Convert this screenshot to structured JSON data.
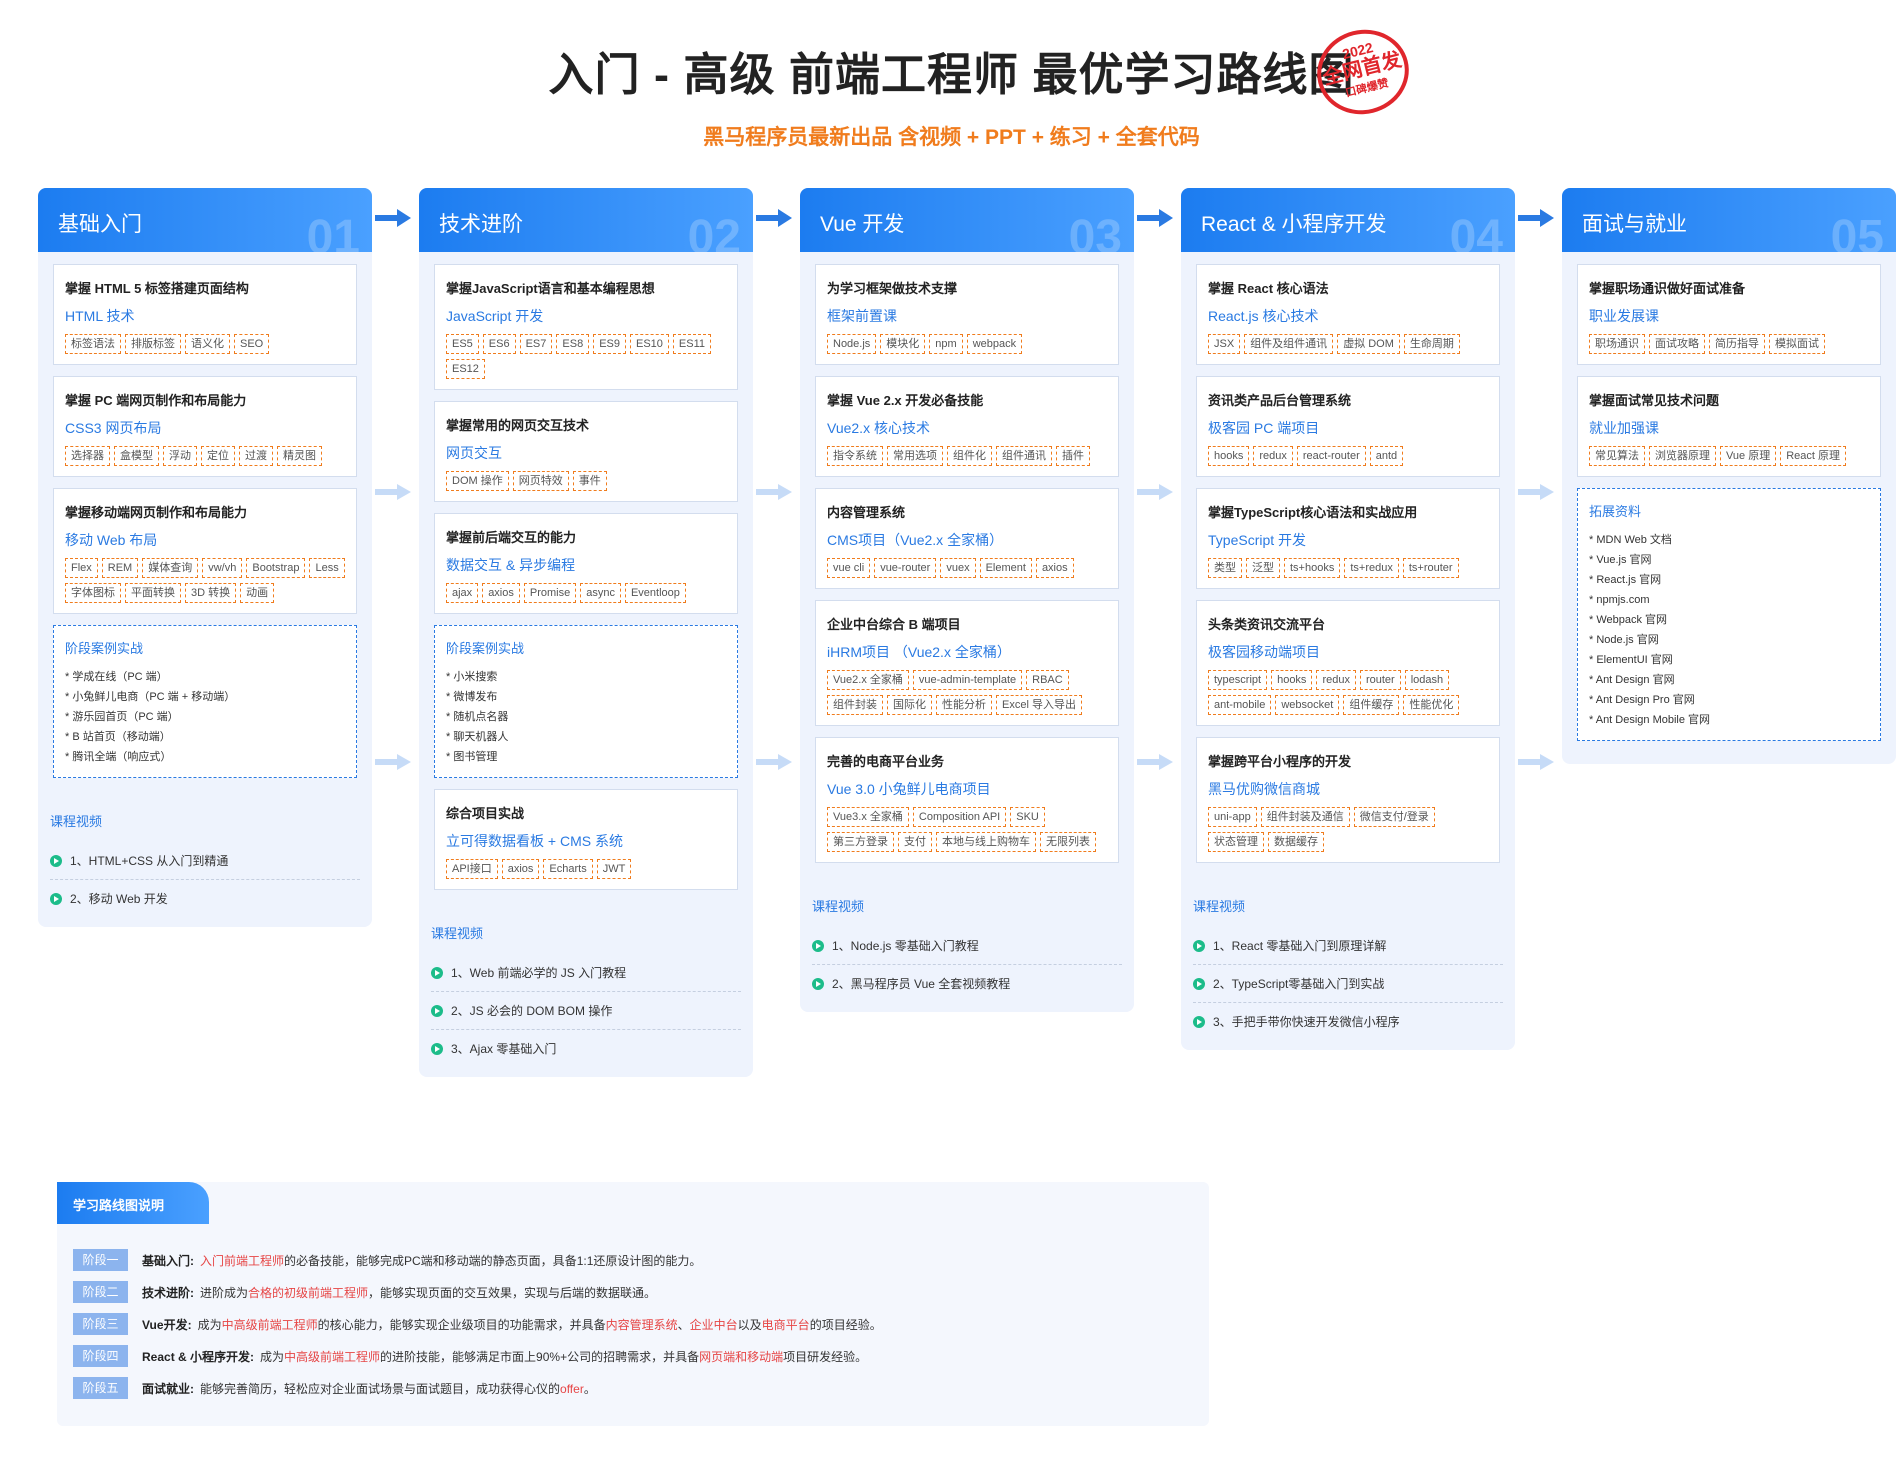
{
  "header": {
    "title": "入门 - 高级 前端工程师 最优学习路线图",
    "subtitle": "黑马程序员最新出品 含视频 + PPT + 练习 + 全套代码",
    "stamp": {
      "year": "2022",
      "main": "全网首发",
      "sub": "口碑爆赞"
    }
  },
  "colors": {
    "primary": "#1c7cf0",
    "accent": "#f07c1d",
    "highlight": "#e64545",
    "play": "#1cbc8a"
  },
  "columns": [
    {
      "title": "基础入门",
      "num": "01",
      "cards": [
        {
          "title": "掌握 HTML 5 标签搭建页面结构",
          "sub": "HTML 技术",
          "tags": [
            "标签语法",
            "排版标签",
            "语义化",
            "SEO"
          ]
        },
        {
          "title": "掌握 PC 端网页制作和布局能力",
          "sub": "CSS3 网页布局",
          "tags": [
            "选择器",
            "盒模型",
            "浮动",
            "定位",
            "过渡",
            "精灵图"
          ]
        },
        {
          "title": "掌握移动端网页制作和布局能力",
          "sub": "移动 Web 布局",
          "tags": [
            "Flex",
            "REM",
            "媒体查询",
            "vw/vh",
            "Bootstrap",
            "Less",
            "字体图标",
            "平面转换",
            "3D 转换",
            "动画"
          ]
        }
      ],
      "case": {
        "title": "阶段案例实战",
        "items": [
          "* 学成在线（PC 端）",
          "* 小兔鲜儿电商（PC 端 + 移动端）",
          "* 游乐园首页（PC 端）",
          "* B 站首页（移动端）",
          "* 腾讯全端（响应式）"
        ]
      },
      "video": {
        "title": "课程视频",
        "items": [
          "1、HTML+CSS 从入门到精通",
          "2、移动 Web 开发"
        ]
      }
    },
    {
      "title": "技术进阶",
      "num": "02",
      "cards": [
        {
          "title": "掌握JavaScript语言和基本编程思想",
          "sub": "JavaScript 开发",
          "tags": [
            "ES5",
            "ES6",
            "ES7",
            "ES8",
            "ES9",
            "ES10",
            "ES11",
            "ES12"
          ]
        },
        {
          "title": "掌握常用的网页交互技术",
          "sub": "网页交互",
          "tags": [
            "DOM 操作",
            "网页特效",
            "事件"
          ]
        },
        {
          "title": "掌握前后端交互的能力",
          "sub": "数据交互 & 异步编程",
          "tags": [
            "ajax",
            "axios",
            "Promise",
            "async",
            "Eventloop"
          ]
        }
      ],
      "case": {
        "title": "阶段案例实战",
        "items": [
          "* 小米搜索",
          "* 微博发布",
          "* 随机点名器",
          "* 聊天机器人",
          "* 图书管理"
        ]
      },
      "cards_after": [
        {
          "title": "综合项目实战",
          "sub": "立可得数据看板 + CMS 系统",
          "tags": [
            "API接口",
            "axios",
            "Echarts",
            "JWT"
          ]
        }
      ],
      "video": {
        "title": "课程视频",
        "items": [
          "1、Web 前端必学的 JS 入门教程",
          "2、JS 必会的 DOM BOM 操作",
          "3、Ajax 零基础入门"
        ]
      }
    },
    {
      "title": "Vue 开发",
      "num": "03",
      "cards": [
        {
          "title": "为学习框架做技术支撑",
          "sub": "框架前置课",
          "tags": [
            "Node.js",
            "模块化",
            "npm",
            "webpack"
          ]
        },
        {
          "title": "掌握 Vue 2.x 开发必备技能",
          "sub": "Vue2.x 核心技术",
          "tags": [
            "指令系统",
            "常用选项",
            "组件化",
            "组件通讯",
            "插件"
          ]
        },
        {
          "title": "内容管理系统",
          "sub": "CMS项目（Vue2.x 全家桶）",
          "tags": [
            "vue cli",
            "vue-router",
            "vuex",
            "Element",
            "axios"
          ]
        },
        {
          "title": "企业中台综合 B 端项目",
          "sub": "iHRM项目 （Vue2.x 全家桶）",
          "tags": [
            "Vue2.x 全家桶",
            "vue-admin-template",
            "RBAC",
            "组件封装",
            "国际化",
            "性能分析",
            "Excel 导入导出"
          ]
        },
        {
          "title": "完善的电商平台业务",
          "sub": "Vue 3.0 小兔鲜儿电商项目",
          "tags": [
            "Vue3.x 全家桶",
            "Composition API",
            "SKU",
            "第三方登录",
            "支付",
            "本地与线上购物车",
            "无限列表"
          ]
        }
      ],
      "video": {
        "title": "课程视频",
        "items": [
          "1、Node.js 零基础入门教程",
          "2、黑马程序员 Vue 全套视频教程"
        ]
      }
    },
    {
      "title": "React & 小程序开发",
      "num": "04",
      "cards": [
        {
          "title": "掌握 React 核心语法",
          "sub": "React.js 核心技术",
          "tags": [
            "JSX",
            "组件及组件通讯",
            "虚拟 DOM",
            "生命周期"
          ]
        },
        {
          "title": "资讯类产品后台管理系统",
          "sub": "极客园 PC 端项目",
          "tags": [
            "hooks",
            "redux",
            "react-router",
            "antd"
          ]
        },
        {
          "title": "掌握TypeScript核心语法和实战应用",
          "sub": "TypeScript 开发",
          "tags": [
            "类型",
            "泛型",
            "ts+hooks",
            "ts+redux",
            "ts+router"
          ]
        },
        {
          "title": "头条类资讯交流平台",
          "sub": "极客园移动端项目",
          "tags": [
            "typescript",
            "hooks",
            "redux",
            "router",
            "lodash",
            "ant-mobile",
            "websocket",
            "组件缓存",
            "性能优化"
          ]
        },
        {
          "title": "掌握跨平台小程序的开发",
          "sub": "黑马优购微信商城",
          "tags": [
            "uni-app",
            "组件封装及通信",
            "微信支付/登录",
            "状态管理",
            "数据缓存"
          ]
        }
      ],
      "video": {
        "title": "课程视频",
        "items": [
          "1、React 零基础入门到原理详解",
          "2、TypeScript零基础入门到实战",
          "3、手把手带你快速开发微信小程序"
        ]
      }
    },
    {
      "title": "面试与就业",
      "num": "05",
      "cards": [
        {
          "title": "掌握职场通识做好面试准备",
          "sub": "职业发展课",
          "tags": [
            "职场通识",
            "面试攻略",
            "简历指导",
            "模拟面试"
          ]
        },
        {
          "title": "掌握面试常见技术问题",
          "sub": "就业加强课",
          "tags": [
            "常见算法",
            "浏览器原理",
            "Vue 原理",
            "React 原理"
          ]
        }
      ],
      "case": {
        "title": "拓展资料",
        "items": [
          "* MDN Web 文档",
          "* Vue.js 官网",
          "* React.js 官网",
          "* npmjs.com",
          "* Webpack 官网",
          "* Node.js 官网",
          "* ElementUI 官网",
          "* Ant Design 官网",
          "* Ant Design Pro 官网",
          "* Ant Design Mobile 官网"
        ]
      }
    }
  ],
  "legend": {
    "title": "学习路线图说明",
    "rows": [
      {
        "badge": "阶段一",
        "name": "基础入门:",
        "parts": [
          {
            "t": "入门前端工程师",
            "h": true
          },
          {
            "t": "的必备技能，能够完成PC端和移动端的静态页面，具备1:1还原设计图的能力。",
            "h": false
          }
        ]
      },
      {
        "badge": "阶段二",
        "name": "技术进阶:",
        "parts": [
          {
            "t": "进阶成为",
            "h": false
          },
          {
            "t": "合格的初级前端工程师",
            "h": true
          },
          {
            "t": "，能够实现页面的交互效果，实现与后端的数据联通。",
            "h": false
          }
        ]
      },
      {
        "badge": "阶段三",
        "name": "Vue开发:",
        "parts": [
          {
            "t": "成为",
            "h": false
          },
          {
            "t": "中高级前端工程师",
            "h": true
          },
          {
            "t": "的核心能力，能够实现企业级项目的功能需求，并具备",
            "h": false
          },
          {
            "t": "内容管理系统",
            "h": true
          },
          {
            "t": "、",
            "h": false
          },
          {
            "t": "企业中台",
            "h": true
          },
          {
            "t": "以及",
            "h": false
          },
          {
            "t": "电商平台",
            "h": true
          },
          {
            "t": "的项目经验。",
            "h": false
          }
        ]
      },
      {
        "badge": "阶段四",
        "name": "React & 小程序开发:",
        "parts": [
          {
            "t": "成为",
            "h": false
          },
          {
            "t": "中高级前端工程师",
            "h": true
          },
          {
            "t": "的进阶技能，能够满足市面上90%+公司的招聘需求，并具备",
            "h": false
          },
          {
            "t": "网页端和移动端",
            "h": true
          },
          {
            "t": "项目研发经验。",
            "h": false
          }
        ]
      },
      {
        "badge": "阶段五",
        "name": "面试就业:",
        "parts": [
          {
            "t": "能够完善简历，轻松应对企业面试场景与面试题目，成功获得心仪的",
            "h": false
          },
          {
            "t": "offer",
            "h": true
          },
          {
            "t": "。",
            "h": false
          }
        ]
      }
    ]
  }
}
